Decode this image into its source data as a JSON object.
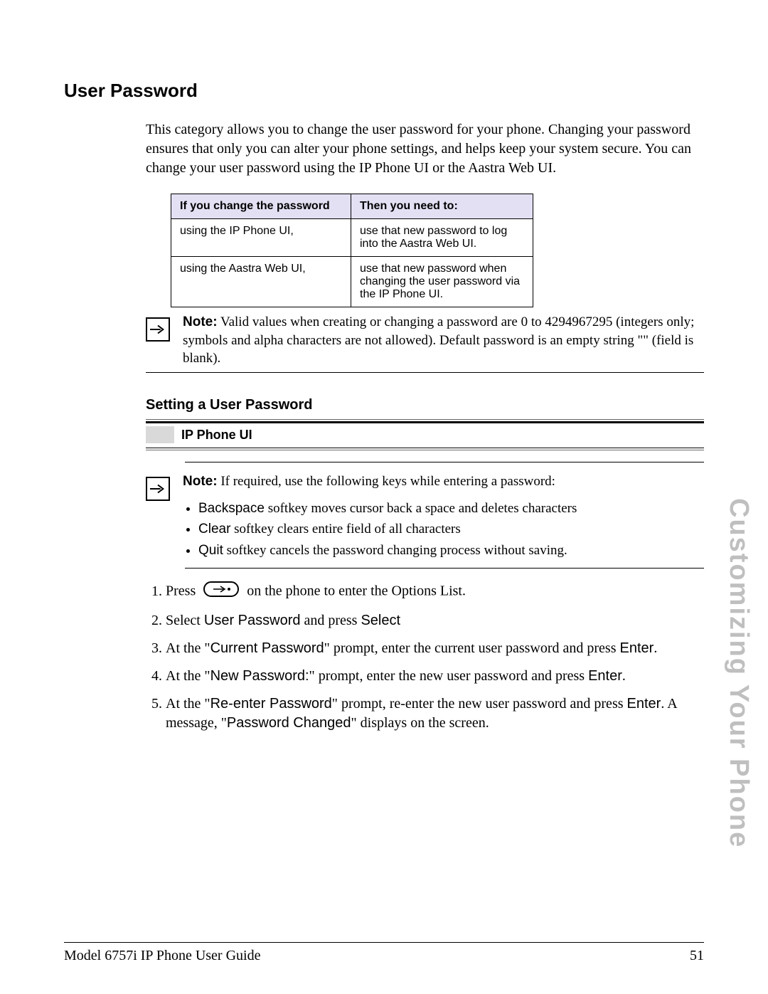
{
  "title": "User Password",
  "intro": "This category allows you to change the user password for your phone. Changing your password ensures that only you can alter your phone settings, and helps keep your system secure. You can change your user password using the IP Phone UI or the Aastra Web UI.",
  "table": {
    "head1": "If you change the password",
    "head2": "Then you need to:",
    "rows": [
      {
        "c1": "using the IP Phone UI,",
        "c2": "use that new password to log into the Aastra Web UI."
      },
      {
        "c1": "using the Aastra Web UI,",
        "c2": "use that new password when changing the user password via the IP Phone UI."
      }
    ]
  },
  "note1": {
    "label": "Note:",
    "text": " Valid values when creating or changing a password are 0 to 4294967295 (integers only; symbols and alpha characters are not allowed). Default password is an empty string \"\" (field is blank)."
  },
  "subhead": "Setting a User Password",
  "uibar": "IP Phone UI",
  "note2": {
    "label": "Note:",
    "lead": " If required, use the following keys while entering a password:",
    "items": [
      {
        "b": "Backspace",
        "t": " softkey moves cursor back a space and deletes characters"
      },
      {
        "b": "Clear",
        "t": " softkey clears entire field of all characters"
      },
      {
        "b": "Quit",
        "t": " softkey cancels the password changing process without saving."
      }
    ]
  },
  "steps": {
    "s1a": "Press ",
    "s1b": " on the phone to enter the Options List.",
    "s2a": "Select ",
    "s2b": "User Password",
    "s2c": " and press ",
    "s2d": "Select",
    "s3a": "At the \"",
    "s3b": "Current Password",
    "s3c": "\" prompt, enter the current user password and press ",
    "s3d": "Enter",
    "s3e": ".",
    "s4a": "At the \"",
    "s4b": "New Password:",
    "s4c": "\" prompt, enter the new user password and press ",
    "s4d": "Enter",
    "s4e": ".",
    "s5a": "At the \"",
    "s5b": "Re-enter Password",
    "s5c": "\" prompt, re-enter the new user password and press ",
    "s5d": "Enter",
    "s5e": ". A message, \"",
    "s5f": "Password Changed",
    "s5g": "\" displays on the screen."
  },
  "side": "Customizing Your Phone",
  "footer_left": "Model 6757i IP Phone User Guide",
  "footer_right": "51"
}
